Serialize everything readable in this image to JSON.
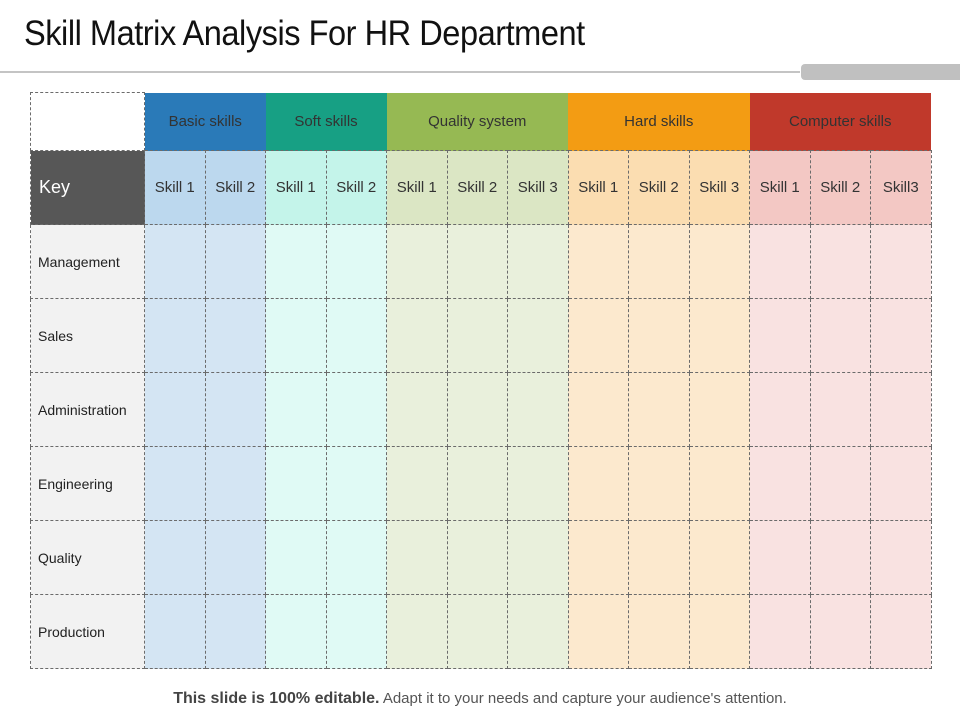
{
  "title": "Skill Matrix Analysis For HR Department",
  "key_label": "Key",
  "groups": [
    {
      "name": "Basic skills",
      "color": "#2a7ab8",
      "header_bg": "#bcd8ee",
      "cell_bg": "#d4e5f3",
      "skills": [
        "Skill 1",
        "Skill 2"
      ]
    },
    {
      "name": "Soft skills",
      "color": "#17a084",
      "header_bg": "#c4f4ea",
      "cell_bg": "#e0faf5",
      "skills": [
        "Skill 1",
        "Skill 2"
      ]
    },
    {
      "name": "Quality system",
      "color": "#96b953",
      "header_bg": "#dbe6c4",
      "cell_bg": "#e9f0dc",
      "skills": [
        "Skill 1",
        "Skill 2",
        "Skill 3"
      ]
    },
    {
      "name": "Hard skills",
      "color": "#f39c13",
      "header_bg": "#fbddb1",
      "cell_bg": "#fce9ce",
      "skills": [
        "Skill 1",
        "Skill 2",
        "Skill 3"
      ]
    },
    {
      "name": "Computer skills",
      "color": "#c0392b",
      "header_bg": "#f3c8c4",
      "cell_bg": "#f9e2e1",
      "skills": [
        "Skill 1",
        "Skill 2",
        "Skill3"
      ]
    }
  ],
  "departments": [
    "Management",
    "Sales",
    "Administration",
    "Engineering",
    "Quality",
    "Production"
  ],
  "footer": {
    "bold": "This slide is 100% editable.",
    "rest": " Adapt it to your needs and capture your audience's attention."
  }
}
